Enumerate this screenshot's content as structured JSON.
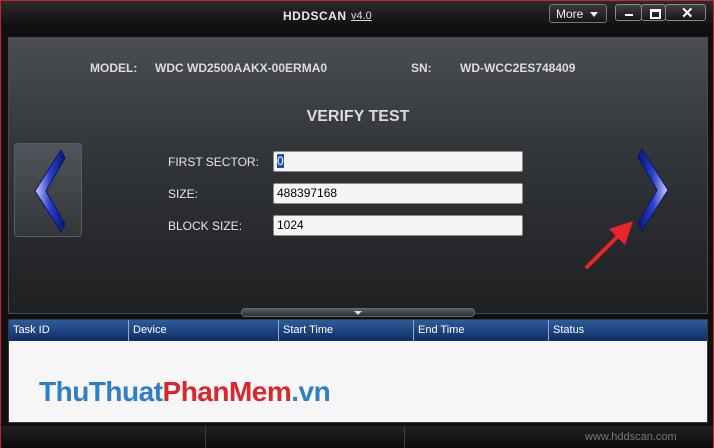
{
  "window": {
    "title": "HDDSCAN",
    "version": "v4.0",
    "more_label": "More"
  },
  "device_info": {
    "model_label": "MODEL:",
    "model_value": "WDC WD2500AAKX-00ERMA0",
    "sn_label": "SN:",
    "sn_value": "WD-WCC2ES748409"
  },
  "test": {
    "heading": "VERIFY TEST",
    "fields": [
      {
        "label": "FIRST SECTOR:",
        "value": "0"
      },
      {
        "label": "SIZE:",
        "value": "488397168"
      },
      {
        "label": "BLOCK SIZE:",
        "value": "1024"
      }
    ]
  },
  "table": {
    "columns": [
      "Task ID",
      "Device",
      "Start Time",
      "End Time",
      "Status"
    ],
    "rows": []
  },
  "statusbar": {
    "site": "www.hddscan.com"
  },
  "watermark": {
    "part1": "ThuThuat",
    "part2": "PhanMem",
    "part3": ".vn"
  },
  "icons": {
    "prev": "chevron-left-icon",
    "next": "chevron-right-icon",
    "annotation": "red-arrow-icon"
  },
  "colors": {
    "accent_blue": "#2a40c8",
    "header_blue": "#1c4585",
    "arrow_red": "#e8242c",
    "window_border": "#c8222a"
  }
}
